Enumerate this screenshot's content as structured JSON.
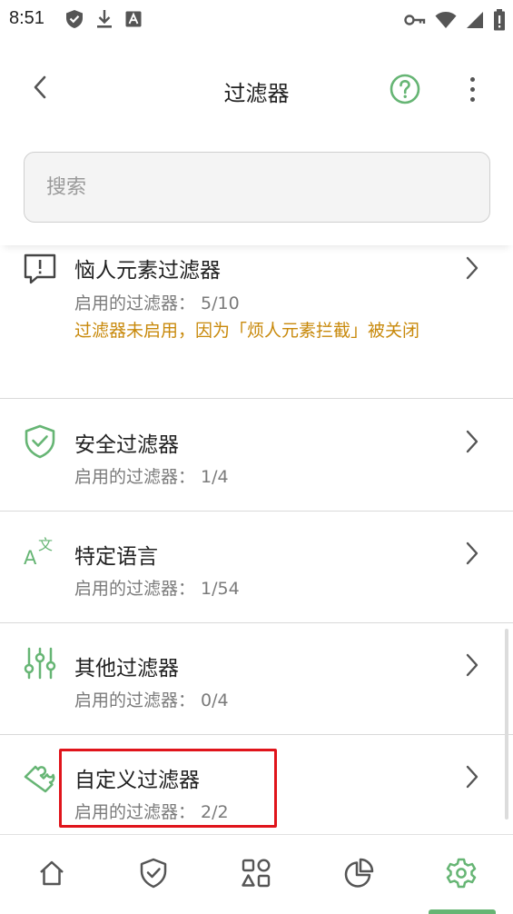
{
  "status_bar": {
    "time": "8:51",
    "left_icons": [
      "shield-check-icon",
      "download-icon",
      "font-a-icon"
    ],
    "right_icons": [
      "key-icon",
      "wifi-icon",
      "signal-icon",
      "battery-alert-icon"
    ]
  },
  "app_bar": {
    "title": "过滤器",
    "back_icon": "chevron-left-icon",
    "help_icon": "help-circle-icon",
    "more_icon": "more-vertical-icon"
  },
  "search": {
    "placeholder": "搜索",
    "value": ""
  },
  "filters": [
    {
      "title": "恼人元素过滤器",
      "subtitle": "启用的过滤器： 5/10",
      "warning": "过滤器未启用，因为「烦人元素拦截」被关闭",
      "icon": "alert-message-icon"
    },
    {
      "title": "安全过滤器",
      "subtitle": "启用的过滤器： 1/4",
      "icon": "shield-check-icon"
    },
    {
      "title": "特定语言",
      "subtitle": "启用的过滤器： 1/54",
      "icon": "translate-icon"
    },
    {
      "title": "其他过滤器",
      "subtitle": "启用的过滤器： 0/4",
      "icon": "sliders-icon"
    },
    {
      "title": "自定义过滤器",
      "subtitle": "启用的过滤器： 2/2",
      "icon": "puzzle-icon",
      "highlighted": true
    }
  ],
  "bottom_nav": {
    "items": [
      "home-icon",
      "shield-icon",
      "apps-icon",
      "pie-chart-icon",
      "settings-icon"
    ],
    "active": "settings-icon"
  },
  "colors": {
    "accent": "#66b574",
    "warning": "#c8890b",
    "highlight": "#e0141b"
  }
}
